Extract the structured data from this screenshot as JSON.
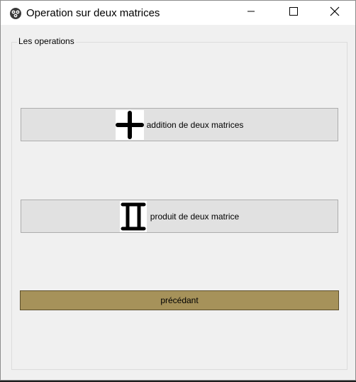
{
  "window": {
    "title": "Operation sur deux matrices",
    "app_icon": "gear-cluster-icon",
    "controls": [
      "minimize-icon",
      "maximize-icon",
      "close-icon"
    ]
  },
  "group": {
    "title": "Les operations"
  },
  "buttons": {
    "addition": {
      "label": "addition de deux matrices",
      "icon": "plus-icon"
    },
    "product": {
      "label": "produit de deux matrice",
      "icon": "pi-product-icon"
    },
    "back": {
      "label": "précédant"
    }
  },
  "colors": {
    "back_button": "#a6925a",
    "button_face": "#e1e1e1",
    "window_bg": "#f0f0f0"
  }
}
